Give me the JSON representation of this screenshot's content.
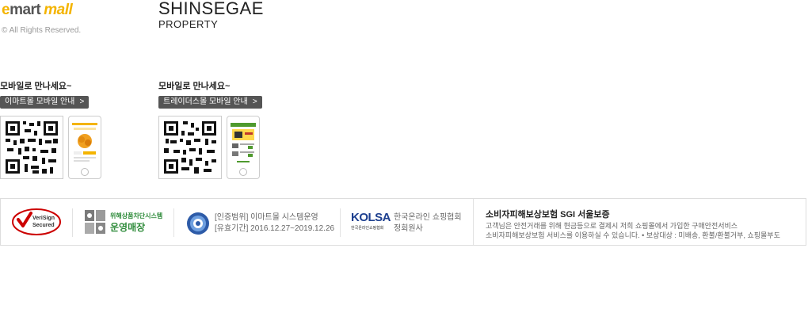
{
  "brand": {
    "emart_e": "e",
    "emart_mart": "mart",
    "emart_mall": "mall",
    "copyright": "© All Rights Reserved.",
    "shinsegae": "SHINSEGAE",
    "property": "PROPERTY"
  },
  "mobile": [
    {
      "title": "모바일로 만나세요~",
      "button": "이마트몰 모바일 안내",
      "chevron": ">"
    },
    {
      "title": "모바일로 만나세요~",
      "button": "트레이더스몰 모바일 안내",
      "chevron": ">"
    }
  ],
  "certs": {
    "verisign_line1": "VeriSign",
    "verisign_line2": "Secured",
    "hazard_line1": "위해상품차단시스템",
    "hazard_line2": "운영매장",
    "isms_line1": "[인증범위] 이마트몰 시스템운영",
    "isms_line2": "[유효기간] 2016.12.27~2019.12.26",
    "kolsa_logo": "KOLSA",
    "kolsa_sub": "한국온라인쇼핑협회",
    "kolsa_line1": "한국온라인 쇼핑협회",
    "kolsa_line2": "정회원사",
    "sgi_title": "소비자피해보상보험  SGI 서울보증",
    "sgi_line1": "고객님은 안전거래를 위해 현금등으로 결제시 저희 쇼핑몰에서 가입한 구매안전서비스",
    "sgi_line2": "소비자피해보상보험 서비스를 이용하실 수 있습니다. • 보상대상 : 미배송, 환불/환불거부, 쇼핑몰부도"
  },
  "colors": {
    "emart_yellow": "#f4b400",
    "button_bg": "#555555",
    "verisign_red": "#cc0000",
    "hazard_green": "#2e8b3a",
    "kolsa_blue": "#1d3f8f",
    "traders_green": "#4f9a2e"
  }
}
